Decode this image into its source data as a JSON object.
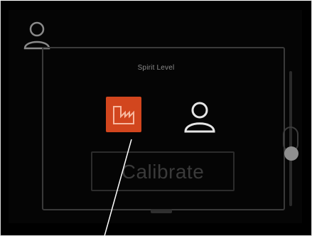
{
  "dialog": {
    "title": "Spirit Level",
    "calibrate_label": "Calibrate"
  },
  "icons": {
    "corner": "user-icon",
    "tool": "factory-icon",
    "center": "user-icon"
  },
  "colors": {
    "background": "#000000",
    "accent": "#d2461e",
    "frame": "#dcdcdc"
  }
}
